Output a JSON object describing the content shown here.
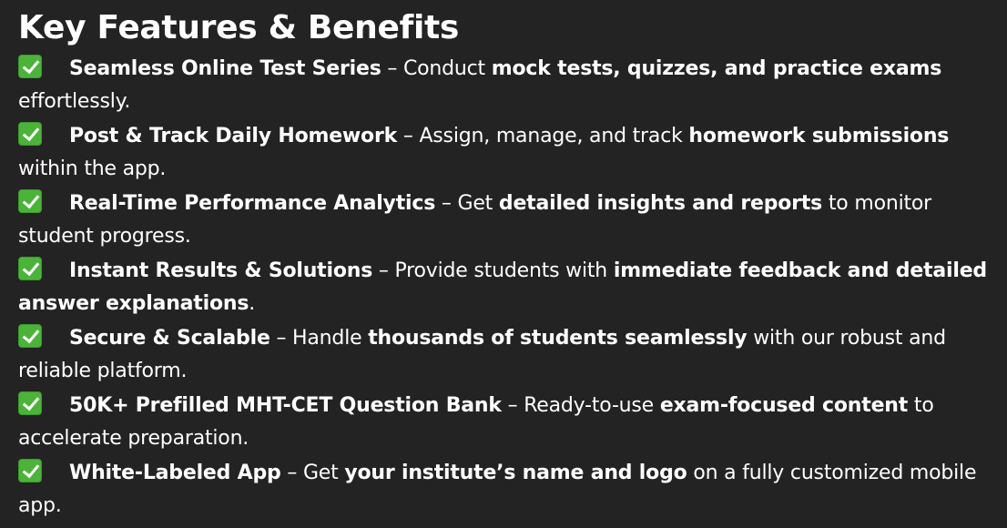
{
  "title": "Key Features & Benefits",
  "features": [
    {
      "icon": "check-mark-icon",
      "heading": "Seamless Online Test Series",
      "sep": " – Conduct ",
      "em": "mock tests, quizzes, and practice exams",
      "rest": " effortlessly."
    },
    {
      "icon": "check-mark-icon",
      "heading": "Post & Track Daily Homework",
      "sep": " – Assign, manage, and track ",
      "em": "homework submissions",
      "rest": " within the app."
    },
    {
      "icon": "check-mark-icon",
      "heading": "Real-Time Performance Analytics",
      "sep": " – Get ",
      "em": "detailed insights and reports",
      "rest": " to monitor student progress."
    },
    {
      "icon": "check-mark-icon",
      "heading": "Instant Results & Solutions",
      "sep": " – Provide students with ",
      "em": "immediate feedback and detailed answer explanations",
      "rest": "."
    },
    {
      "icon": "check-mark-icon",
      "heading": "Secure & Scalable",
      "sep": " – Handle ",
      "em": "thousands of students seamlessly",
      "rest": " with our robust and reliable platform."
    },
    {
      "icon": "check-mark-icon",
      "heading": "50K+ Prefilled MHT-CET Question Bank",
      "sep": " – Ready-to-use ",
      "em": "exam-focused content",
      "rest": " to accelerate preparation."
    },
    {
      "icon": "check-mark-icon",
      "heading": "White-Labeled App",
      "sep": " – Get ",
      "em": "your institute’s name and logo",
      "rest": " on a fully customized mobile app."
    }
  ],
  "colors": {
    "background": "#232323",
    "text": "#ffffff",
    "check_green": "#4cb33a"
  }
}
